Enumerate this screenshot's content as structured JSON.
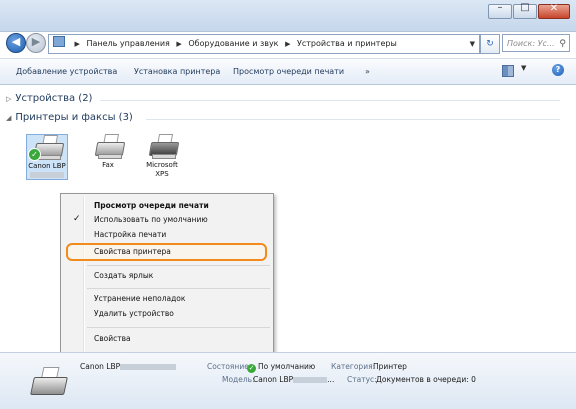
{
  "window": {
    "controls": {
      "minimize": "–",
      "maximize": "□",
      "close": "✕"
    }
  },
  "address_bar": {
    "back_icon": "back-arrow-icon",
    "forward_icon": "forward-arrow-icon",
    "crumbs": [
      "Панель управления",
      "Оборудование и звук",
      "Устройства и принтеры"
    ],
    "refresh_icon": "refresh-icon",
    "search_placeholder": "Поиск: Ус...",
    "search_icon": "magnifier-icon"
  },
  "toolbar": {
    "items": [
      "Добавление устройства",
      "Установка принтера",
      "Просмотр очереди печати",
      "»"
    ],
    "help_label": "?"
  },
  "groups": {
    "devices_label": "Устройства (2)",
    "printers_label": "Принтеры и факсы (3)"
  },
  "printers": [
    {
      "label": "Canon LBP",
      "name_icon": "printer-icon",
      "default": true
    },
    {
      "label": "Fax",
      "name_icon": "fax-icon",
      "default": false
    },
    {
      "label": "Microsoft XPS",
      "name_icon": "printer-icon",
      "default": false
    }
  ],
  "context_menu": {
    "items": [
      {
        "label": "Просмотр очереди печати",
        "bold": true
      },
      {
        "label": "Использовать по умолчанию",
        "checked": true
      },
      {
        "label": "Настройка печати"
      },
      {
        "label": "Свойства принтера",
        "highlighted": true
      },
      {
        "label": "Создать ярлык"
      },
      {
        "label": "Устранение неполадок"
      },
      {
        "label": "Удалить устройство"
      },
      {
        "label": "Свойства"
      }
    ],
    "highlight_color": "#f28a1c"
  },
  "details": {
    "name": "Canon LBP",
    "state_key": "Состояние:",
    "state_value": "По умолчанию",
    "model_key": "Модель:",
    "model_value": "Canon LBP",
    "category_key": "Категория:",
    "category_value": "Принтер",
    "status_key": "Статус:",
    "status_value": "Документов в очереди: 0"
  }
}
